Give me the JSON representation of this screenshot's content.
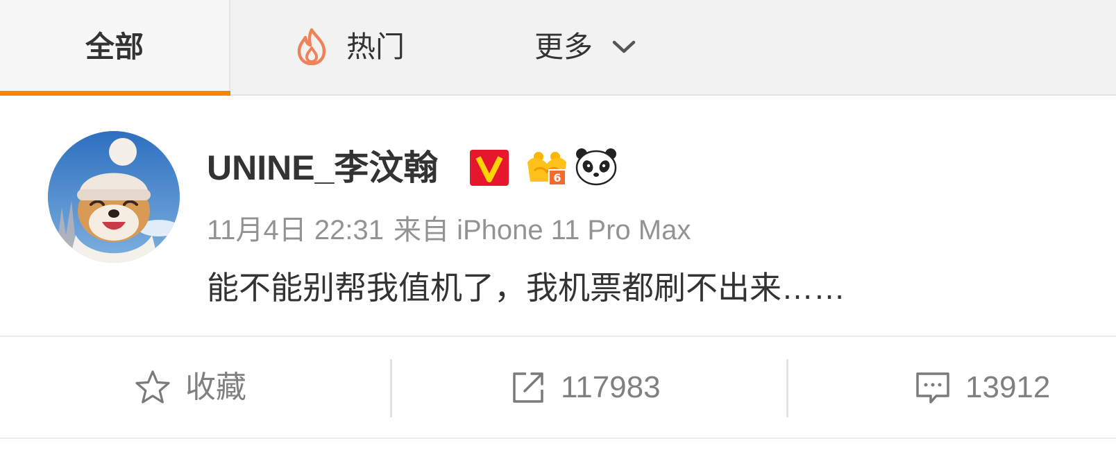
{
  "tabs": {
    "all_label": "全部",
    "hot_label": "热门",
    "more_label": "更多"
  },
  "post": {
    "author": "UNINE_李汶翰",
    "badges": [
      "verified-v-badge",
      "vip-crown-level-6-badge",
      "panda-badge"
    ],
    "vip_level": "6",
    "time": "11月4日 22:31",
    "source": "来自 iPhone 11 Pro Max",
    "text": "能不能别帮我值机了，我机票都刷不出来……"
  },
  "actions": {
    "favorite_label": "收藏",
    "repost_count": "117983",
    "comment_count": "13912"
  },
  "colors": {
    "accent": "#ff8200",
    "verified": "#e6162d",
    "text": "#333333",
    "meta": "#939393"
  }
}
